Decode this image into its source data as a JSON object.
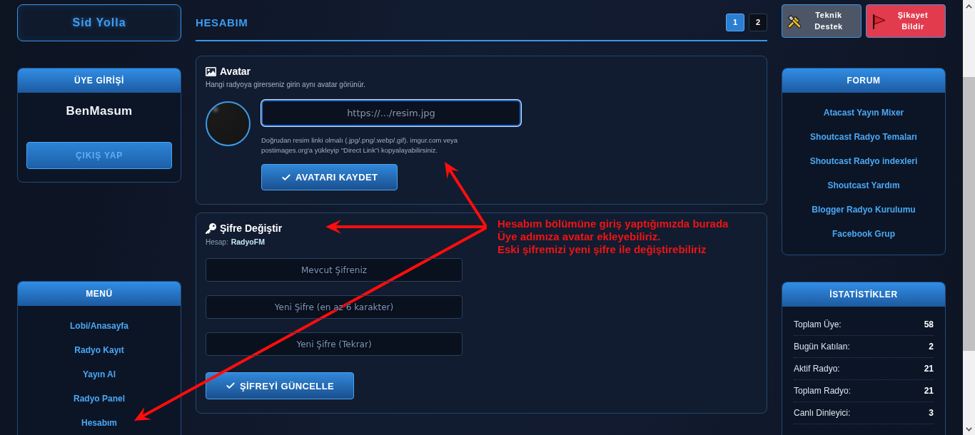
{
  "sidebar_left": {
    "brand": "Sid Yolla",
    "login_panel": {
      "title": "ÜYE GİRİŞİ",
      "username": "BenMasum",
      "logout_button": "ÇIKIŞ YAP"
    },
    "menu": {
      "title": "MENÜ",
      "items": [
        {
          "label": "Lobi/Anasayfa"
        },
        {
          "label": "Radyo Kayıt"
        },
        {
          "label": "Yayın Al"
        },
        {
          "label": "Radyo Panel"
        },
        {
          "label": "Hesabım"
        }
      ]
    }
  },
  "main": {
    "title": "HESABIM",
    "pages": [
      {
        "label": "1",
        "selected": true
      },
      {
        "label": "2",
        "selected": false
      }
    ],
    "avatar_card": {
      "title": "Avatar",
      "subtitle": "Hangi radyoya girerseniz girin aynı avatar görünür.",
      "url_field": {
        "placeholder": "https://.../resim.jpg",
        "focused": true
      },
      "note": "Doğrudan resim linki olmalı (.jpg/.png/.webp/.gif). imgur.com veya postimages.org'a yükleyip \"Direct Link\"i kopyalayabilirsiniz.",
      "save_button": "AVATARI KAYDET"
    },
    "password_card": {
      "title": "Şifre Değiştir",
      "account_label": "Hesap:",
      "account_name": "RadyoFM",
      "fields": [
        {
          "placeholder": "Mevcut Şifreniz"
        },
        {
          "placeholder": "Yeni Şifre (en az 6 karakter)"
        },
        {
          "placeholder": "Yeni Şifre (Tekrar)"
        }
      ],
      "update_button": "ŞİFREYİ GÜNCELLE"
    }
  },
  "sidebar_right": {
    "action_buttons": [
      {
        "kind": "support",
        "label": "Teknik Destek"
      },
      {
        "kind": "report",
        "label": "Şikayet Bildir"
      }
    ],
    "forum": {
      "title": "FORUM",
      "links": [
        {
          "label": "Atacast Yayın Mixer"
        },
        {
          "label": "Shoutcast Radyo Temaları"
        },
        {
          "label": "Shoutcast Radyo indexleri"
        },
        {
          "label": "Shoutcast Yardım"
        },
        {
          "label": "Blogger Radyo Kurulumu"
        },
        {
          "label": "Facebook Grup"
        }
      ]
    },
    "stats": {
      "title": "İSTATİSTİKLER",
      "rows": [
        {
          "label": "Toplam Üye:",
          "value": "58"
        },
        {
          "label": "Bugün Katılan:",
          "value": "2"
        },
        {
          "label": "Aktif Radyo:",
          "value": "21"
        },
        {
          "label": "Toplam Radyo:",
          "value": "21"
        },
        {
          "label": "Canlı Dinleyici:",
          "value": "3"
        }
      ]
    }
  },
  "annotation": {
    "lines": [
      "Hesabım bölümüne giriş yaptığımızda burada",
      "Üye adımıza avatar ekleyebiliriz.",
      "Eski şifremizi yeni şifre ile değiştirebiliriz"
    ]
  }
}
